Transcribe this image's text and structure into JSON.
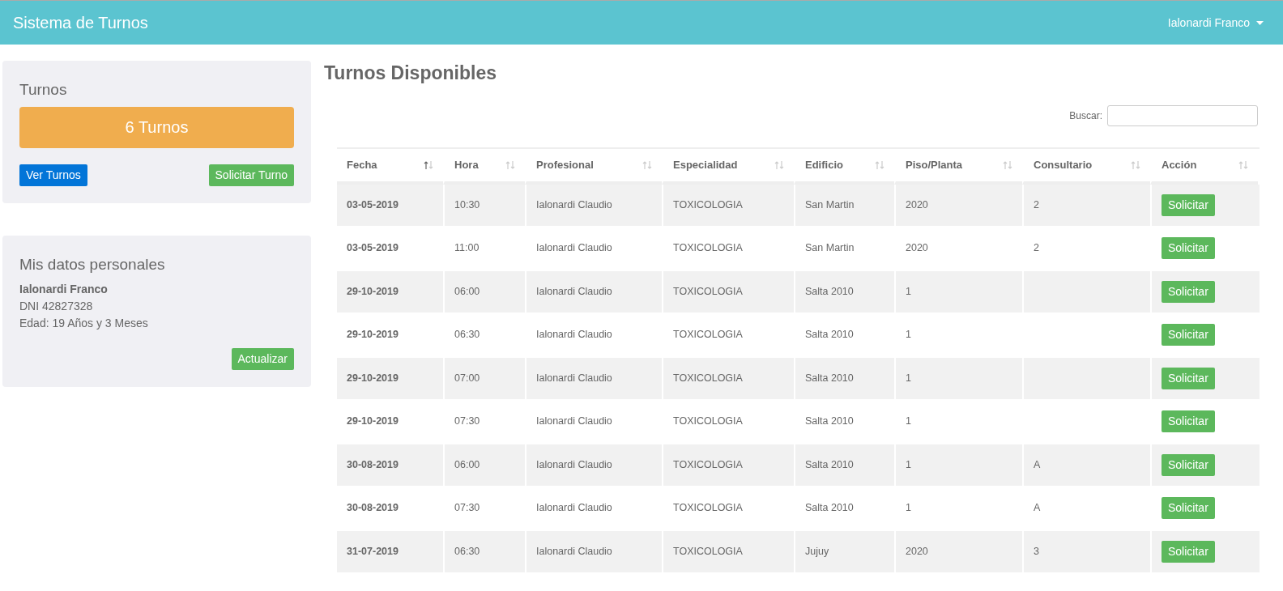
{
  "navbar": {
    "brand": "Sistema de Turnos",
    "user": "Ialonardi Franco"
  },
  "turnos_card": {
    "title": "Turnos",
    "count": "6 Turnos",
    "buttons": [
      {
        "label": "Ver Turnos",
        "kind": "primary"
      },
      {
        "label": "Solicitar Turno",
        "kind": "success"
      }
    ]
  },
  "personal_card": {
    "title": "Mis datos personales",
    "name": "Ialonardi Franco",
    "dni": "DNI 42827328",
    "age": "Edad: 19 Años y 3 Meses",
    "button": "Actualizar"
  },
  "main": {
    "title": "Turnos Disponibles",
    "search": {
      "label": "Buscar:"
    }
  },
  "table": {
    "columns": [
      {
        "label": "Fecha",
        "sorted": true
      },
      {
        "label": "Hora",
        "sorted": false
      },
      {
        "label": "Profesional",
        "sorted": false
      },
      {
        "label": "Especialidad",
        "sorted": false
      },
      {
        "label": "Edificio",
        "sorted": false
      },
      {
        "label": "Piso/Planta",
        "sorted": false
      },
      {
        "label": "Consultario",
        "sorted": false
      },
      {
        "label": "Acción",
        "sorted": false
      }
    ],
    "rows": [
      {
        "cells": [
          "03-05-2019",
          "10:30",
          "Ialonardi Claudio",
          "TOXICOLOGIA",
          "San Martin",
          "2020",
          "2"
        ],
        "action": "Solicitar"
      },
      {
        "cells": [
          "03-05-2019",
          "11:00",
          "Ialonardi Claudio",
          "TOXICOLOGIA",
          "San Martin",
          "2020",
          "2"
        ],
        "action": "Solicitar"
      },
      {
        "cells": [
          "29-10-2019",
          "06:00",
          "Ialonardi Claudio",
          "TOXICOLOGIA",
          "Salta 2010",
          "1",
          null
        ],
        "action": "Solicitar"
      },
      {
        "cells": [
          "29-10-2019",
          "06:30",
          "Ialonardi Claudio",
          "TOXICOLOGIA",
          "Salta 2010",
          "1",
          null
        ],
        "action": "Solicitar"
      },
      {
        "cells": [
          "29-10-2019",
          "07:00",
          "Ialonardi Claudio",
          "TOXICOLOGIA",
          "Salta 2010",
          "1",
          null
        ],
        "action": "Solicitar"
      },
      {
        "cells": [
          "29-10-2019",
          "07:30",
          "Ialonardi Claudio",
          "TOXICOLOGIA",
          "Salta 2010",
          "1",
          null
        ],
        "action": "Solicitar"
      },
      {
        "cells": [
          "30-08-2019",
          "06:00",
          "Ialonardi Claudio",
          "TOXICOLOGIA",
          "Salta 2010",
          "1",
          "A"
        ],
        "action": "Solicitar"
      },
      {
        "cells": [
          "30-08-2019",
          "07:30",
          "Ialonardi Claudio",
          "TOXICOLOGIA",
          "Salta 2010",
          "1",
          "A"
        ],
        "action": "Solicitar"
      },
      {
        "cells": [
          "31-07-2019",
          "06:30",
          "Ialonardi Claudio",
          "TOXICOLOGIA",
          "Jujuy",
          "2020",
          "3"
        ],
        "action": "Solicitar"
      }
    ]
  }
}
